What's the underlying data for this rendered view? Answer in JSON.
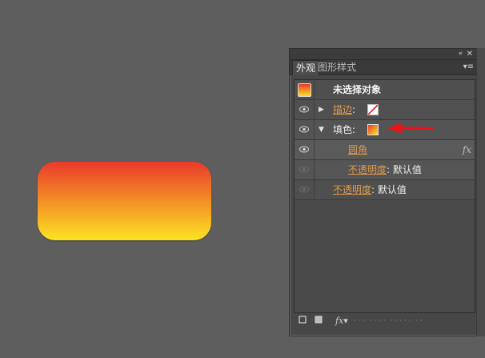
{
  "canvas": {
    "gradient_top": "#e93a2a",
    "gradient_bottom": "#fde321"
  },
  "panel": {
    "collapse_icon": "«",
    "close_icon": "✕",
    "tabs": [
      {
        "label": "外观"
      },
      {
        "label": "图形样式"
      }
    ],
    "menu_icon": "▾≡",
    "object_label": "未选择对象",
    "stroke_label": "描边",
    "fill_label": "填色",
    "round_corner_label": "圆角",
    "fx_label": "fx",
    "opacity_inner_label": "不透明度",
    "opacity_inner_value": "默认值",
    "opacity_outer_label": "不透明度",
    "opacity_outer_value": "默认值",
    "colon": ":",
    "bottom_fx": "fx▾",
    "accent_color": "#e29a4c",
    "arrow_color": "#e8141a"
  }
}
